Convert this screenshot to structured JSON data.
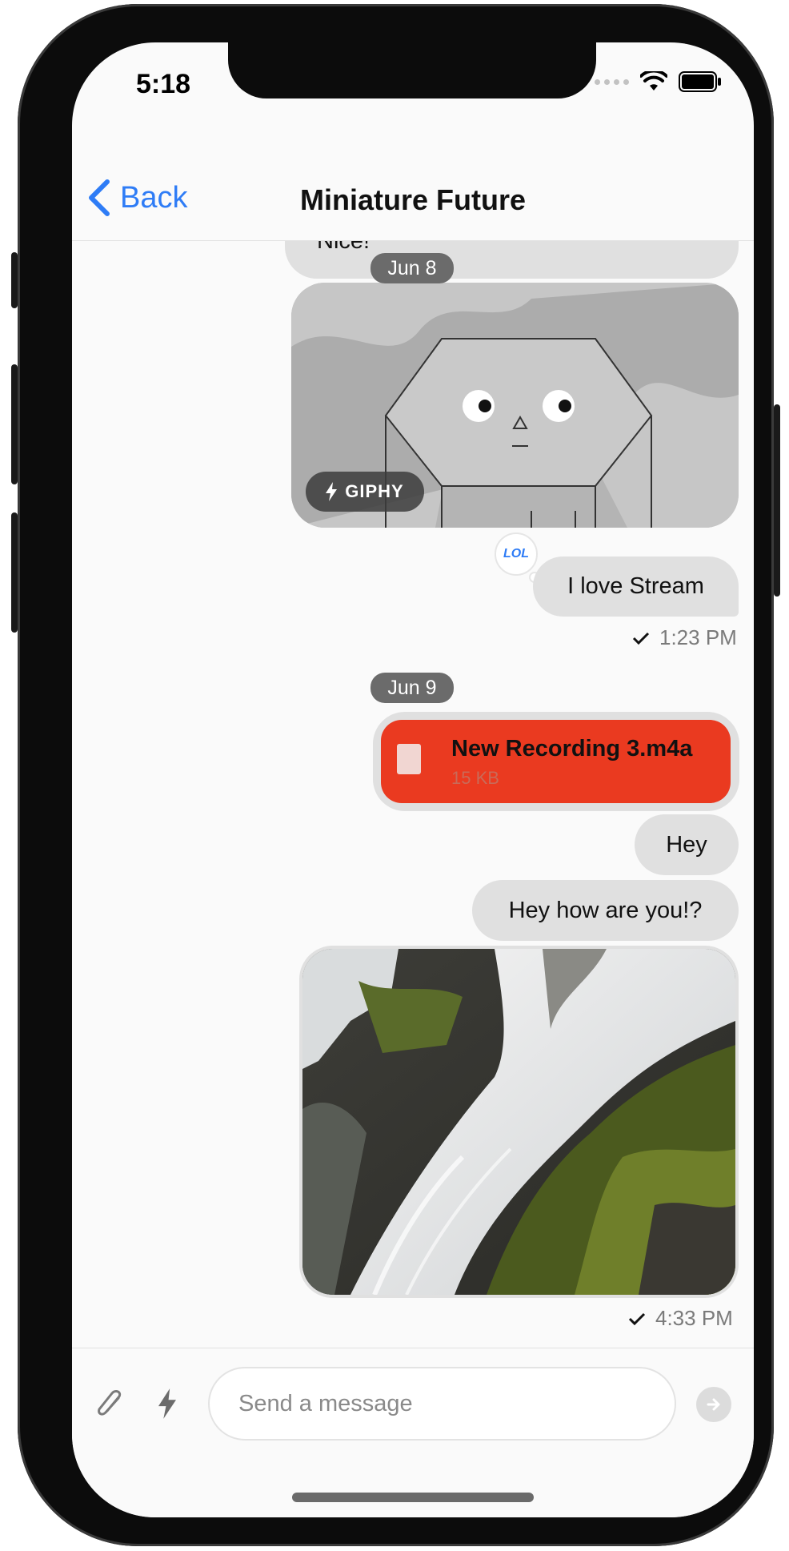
{
  "status_bar": {
    "time": "5:18"
  },
  "header": {
    "back_label": "Back",
    "title": "Miniature Future"
  },
  "messages": {
    "nice_text": "Nice!",
    "date_1": "Jun 8",
    "giphy_badge": "GIPHY",
    "reaction": "LOL",
    "love_text": "I love Stream",
    "love_time": "1:23 PM",
    "date_2": "Jun 9",
    "file_name": "New Recording 3.m4a",
    "file_size": "15 KB",
    "hey_text": "Hey",
    "hey_how_text": "Hey how are you!?",
    "photo_time": "4:33 PM"
  },
  "composer": {
    "placeholder": "Send a message"
  },
  "colors": {
    "accent": "#2e7cf6",
    "file_card": "#ea3a20",
    "bubble": "#e0e0e0"
  },
  "icons": [
    "chevron-left-icon",
    "wifi-icon",
    "battery-icon",
    "checkmark-icon",
    "bolt-icon",
    "paperclip-icon",
    "send-arrow-icon",
    "file-icon"
  ]
}
